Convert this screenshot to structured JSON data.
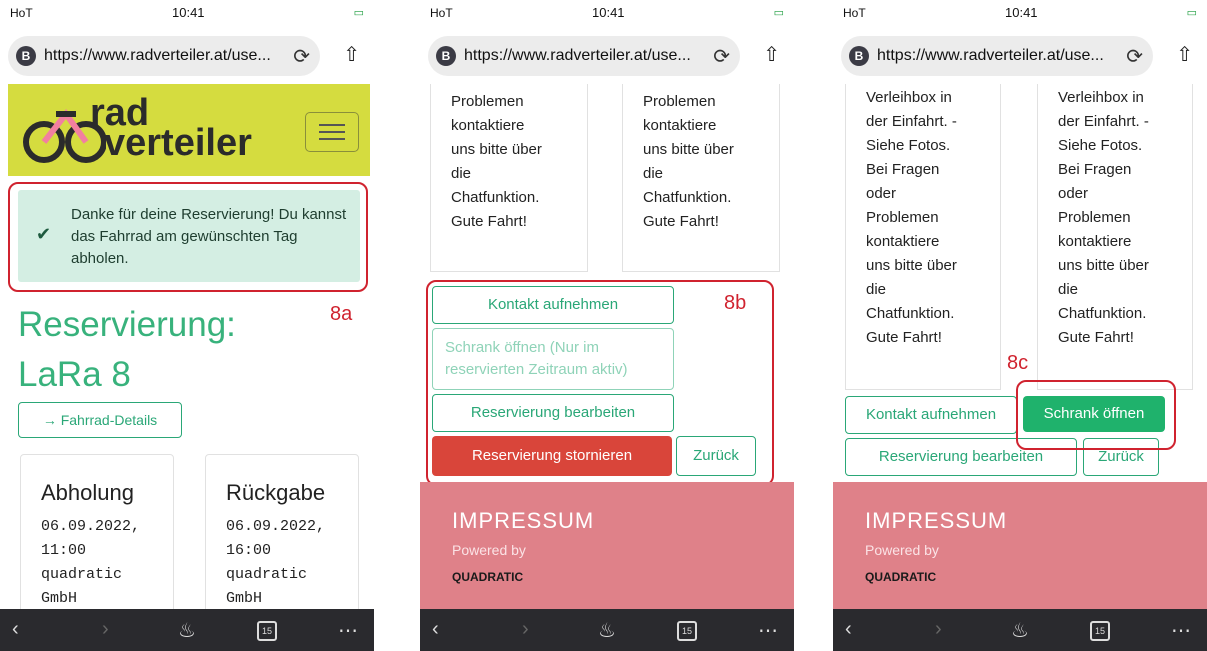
{
  "status_bar": {
    "carrier": "HoT",
    "time": "10:41",
    "battery": "⚡"
  },
  "browser": {
    "badge": "B",
    "url": "https://www.radverteiler.at/use...",
    "reload_icon": "reload-icon",
    "share_icon": "share-icon",
    "tabs_count": "15"
  },
  "logo": {
    "line1": "rad",
    "line2": "verteiler"
  },
  "screen1": {
    "alert_text": "Danke für deine Reservierung! Du kannst das Fahrrad am gewünschten Tag abholen.",
    "annotation": "8a",
    "title_line1": "Reservierung:",
    "title_line2": "LaRa 8",
    "details_button": "→ Fahrrad-Details",
    "pickup": {
      "title": "Abholung",
      "body": "06.09.2022,\n11:00\nquadratic\nGmbH"
    },
    "return": {
      "title": "Rückgabe",
      "body": "06.09.2022,\n16:00\nquadratic\nGmbH"
    }
  },
  "screen2": {
    "col_text": "Problemen\nkontaktiere\nuns bitte über\ndie\nChatfunktion.\nGute Fahrt!",
    "annotation": "8b",
    "btn_contact": "Kontakt aufnehmen",
    "btn_open_disabled": "Schrank öffnen (Nur im reservierten Zeitraum aktiv)",
    "btn_edit": "Reservierung bearbeiten",
    "btn_cancel": "Reservierung stornieren",
    "btn_back": "Zurück"
  },
  "screen3": {
    "col_text": "Verleihbox in\nder Einfahrt. -\nSiehe Fotos.\nBei Fragen\noder\nProblemen\nkontaktiere\nuns bitte über\ndie\nChatfunktion.\nGute Fahrt!",
    "annotation": "8c",
    "btn_contact": "Kontakt aufnehmen",
    "btn_open": "Schrank öffnen",
    "btn_edit": "Reservierung bearbeiten",
    "btn_back": "Zurück"
  },
  "footer": {
    "title": "IMPRESSUM",
    "powered": "Powered by",
    "company": "QUADRATIC"
  },
  "colors": {
    "accent_green": "#2aa777",
    "logo_bg": "#d5dc3f",
    "footer_pink": "#df8189",
    "danger": "#d9453a",
    "annotation_red": "#d0232f"
  }
}
